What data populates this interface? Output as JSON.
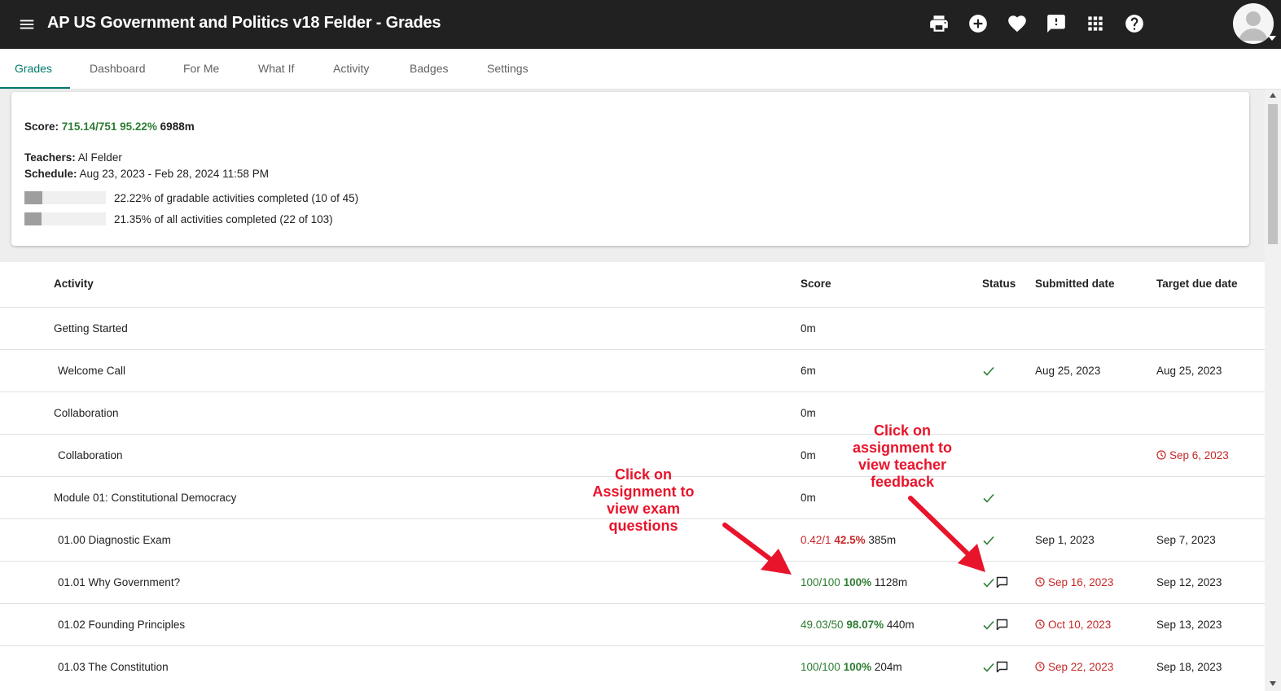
{
  "header": {
    "title": "AP US Government and Politics v18 Felder - Grades",
    "icons": [
      "menu-icon",
      "print-icon",
      "add-circle-icon",
      "heart-icon",
      "feedback-icon",
      "apps-icon",
      "help-icon"
    ]
  },
  "tabs": [
    {
      "label": "Grades",
      "active": true
    },
    {
      "label": "Dashboard"
    },
    {
      "label": "For Me"
    },
    {
      "label": "What If"
    },
    {
      "label": "Activity"
    },
    {
      "label": "Badges"
    },
    {
      "label": "Settings"
    }
  ],
  "summary": {
    "score_label": "Score:",
    "score_value": "715.14/751 95.22%",
    "score_time": "6988m",
    "teachers_label": "Teachers:",
    "teachers_value": "Al Felder",
    "schedule_label": "Schedule:",
    "schedule_value": "Aug 23, 2023 - Feb 28, 2024 11:58 PM",
    "progress": [
      {
        "label": "22.22% of gradable activities completed (10 of 45)",
        "fraction": 0.2222
      },
      {
        "label": "21.35% of all activities completed (22 of 103)",
        "fraction": 0.2135
      }
    ]
  },
  "table": {
    "headers": {
      "activity": "Activity",
      "score": "Score",
      "status": "Status",
      "submitted": "Submitted date",
      "due": "Target due date"
    },
    "rows": [
      {
        "activity": "Getting Started",
        "score_time": "0m"
      },
      {
        "activity": "Welcome Call",
        "score_time": "6m",
        "check": true,
        "submitted": "Aug 25, 2023",
        "due": "Aug 25, 2023"
      },
      {
        "activity": "Collaboration",
        "score_time": "0m"
      },
      {
        "activity": "Collaboration",
        "score_time": "0m",
        "due": "Sep 6, 2023",
        "due_late": true
      },
      {
        "activity": "Module 01: Constitutional Democracy",
        "score_time": "0m",
        "check": true
      },
      {
        "activity": "01.00 Diagnostic Exam",
        "score_frac": "0.42/1",
        "score_pct": "42.5%",
        "score_time": "385m",
        "score_color": "red",
        "check": true,
        "submitted": "Sep 1, 2023",
        "due": "Sep 7, 2023"
      },
      {
        "activity": "01.01 Why Government?",
        "score_frac": "100/100",
        "score_pct": "100%",
        "score_time": "1128m",
        "score_color": "green",
        "check": true,
        "chat": true,
        "submitted": "Sep 16, 2023",
        "submitted_late": true,
        "due": "Sep 12, 2023"
      },
      {
        "activity": "01.02 Founding Principles",
        "score_frac": "49.03/50",
        "score_pct": "98.07%",
        "score_time": "440m",
        "score_color": "green",
        "check": true,
        "chat": true,
        "submitted": "Oct 10, 2023",
        "submitted_late": true,
        "due": "Sep 13, 2023"
      },
      {
        "activity": "01.03 The Constitution",
        "score_frac": "100/100",
        "score_pct": "100%",
        "score_time": "204m",
        "score_color": "green",
        "check": true,
        "chat": true,
        "submitted": "Sep 22, 2023",
        "submitted_late": true,
        "due": "Sep 18, 2023"
      }
    ]
  },
  "annotations": [
    {
      "text": "Click on\nAssignment to\nview exam\nquestions"
    },
    {
      "text": "Click on\nassignment to\nview teacher\nfeedback"
    }
  ],
  "colors": {
    "accent": "#00796b",
    "green": "#2e7d32",
    "red": "#c62828",
    "annotation": "#e8142b",
    "topbar": "#212121"
  }
}
